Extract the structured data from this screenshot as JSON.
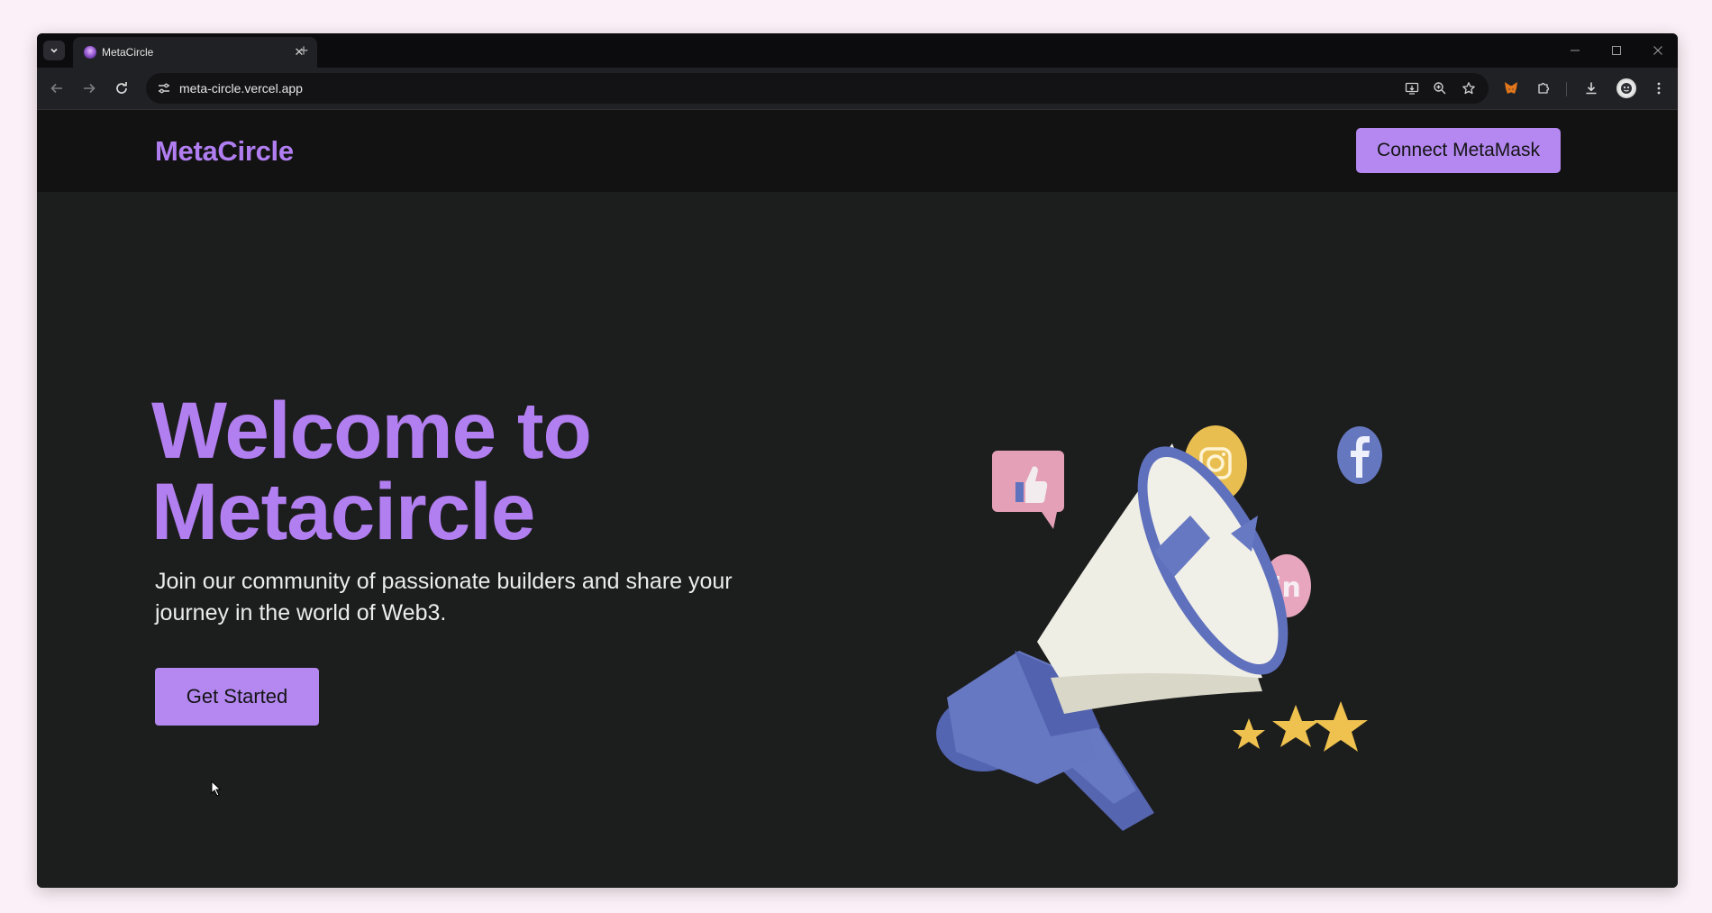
{
  "browser": {
    "tab": {
      "title": "MetaCircle"
    },
    "address_bar": {
      "url": "meta-circle.vercel.app"
    }
  },
  "site": {
    "brand": "MetaCircle",
    "connect_button": "Connect MetaMask",
    "hero": {
      "title_line1": "Welcome to",
      "title_line2": "Metacircle",
      "subtitle": "Join our community of passionate builders and share your journey in the world of Web3.",
      "cta": "Get Started"
    }
  },
  "colors": {
    "accent": "#b488f0",
    "page_background": "#1c1d1d",
    "navbar_background": "#121212",
    "browser_chrome": "#202125"
  },
  "illustration": {
    "subject": "megaphone",
    "elements": [
      "thumbs-up-bubble",
      "instagram-badge",
      "facebook-badge",
      "linkedin-badge",
      "three-stars"
    ]
  }
}
